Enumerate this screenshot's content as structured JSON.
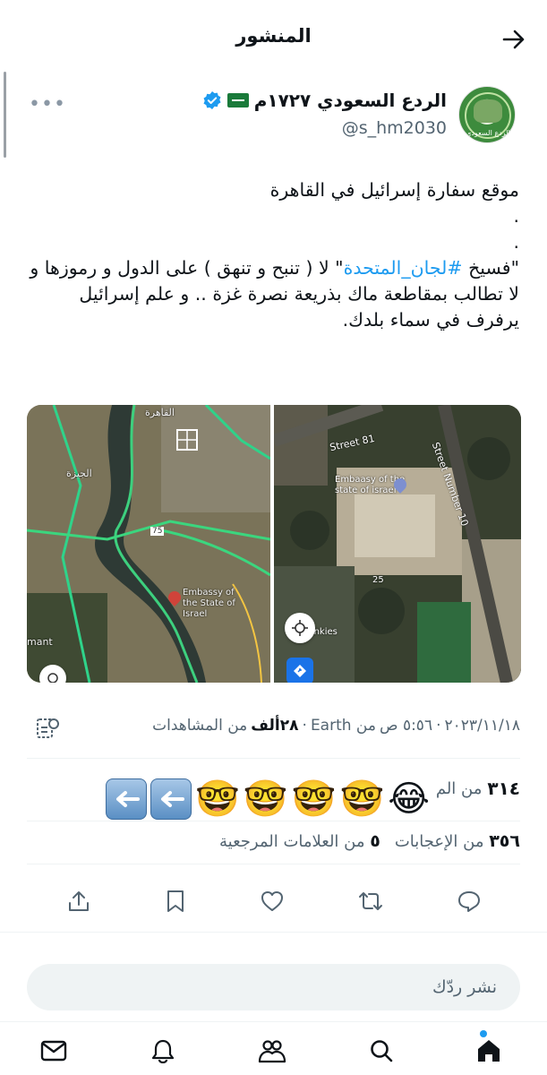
{
  "header": {
    "title": "المنشور"
  },
  "post": {
    "author_name": "الردع السعودي ١٧٢٧م",
    "handle": "@s_hm2030",
    "avatar_caption": "الردع السعودي",
    "text_line1": "موقع سفارة إسرائيل في القاهرة",
    "dot1": ".",
    "dot2": ".",
    "text_pre_hashtag": "\"فسيخ ",
    "hashtag": "#لجان_المتحدة",
    "text_post_hashtag": "\" لا ( تنبح و تنهق ) على الدول و رموزها و لا تطالب بمقاطعة ماك بذريعة نصرة غزة .. و علم إسرائيل يرفرف في سماء بلدك.",
    "map_left_labels": {
      "cairo": "القاهرة",
      "giza": "الجيزة",
      "road": "75",
      "embassy_en": "Embassy of the State of Israel",
      "edge": "mant"
    },
    "map_right_labels": {
      "street81": "Street 81",
      "street10": "Street Number 10",
      "embassy_en": "Embaasy of the state of israel",
      "num": "25",
      "drinkies": "Drinkies"
    },
    "meta": {
      "date": "٢٠٢٣/١١/١٨",
      "time": "٥:٥٦ ص",
      "source": "من Earth",
      "views_count": "٢٨ألف",
      "views_label": "من المشاهدات"
    },
    "quote_count": "٣١٤",
    "quote_label": "من الم",
    "likes_count": "٣٥٦",
    "likes_label": "من الإعجابات",
    "bookmarks_count": "٥",
    "bookmarks_label": "من العلامات المرجعية"
  },
  "reply_placeholder": "نشر ردّك",
  "colors": {
    "accent": "#1d9bf0",
    "text": "#0f1419",
    "muted": "#536471"
  }
}
